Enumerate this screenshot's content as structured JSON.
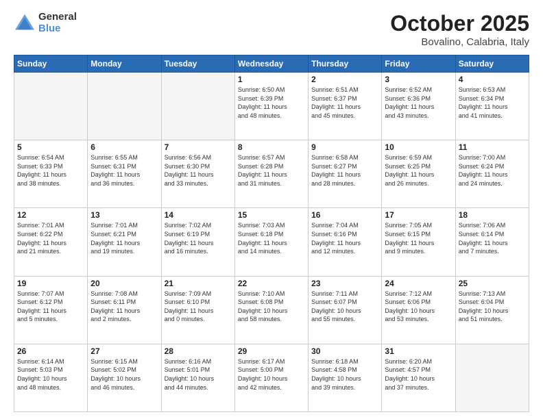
{
  "header": {
    "logo_line1": "General",
    "logo_line2": "Blue",
    "title": "October 2025",
    "subtitle": "Bovalino, Calabria, Italy"
  },
  "days_of_week": [
    "Sunday",
    "Monday",
    "Tuesday",
    "Wednesday",
    "Thursday",
    "Friday",
    "Saturday"
  ],
  "weeks": [
    {
      "days": [
        {
          "num": "",
          "info": ""
        },
        {
          "num": "",
          "info": ""
        },
        {
          "num": "",
          "info": ""
        },
        {
          "num": "1",
          "info": "Sunrise: 6:50 AM\nSunset: 6:39 PM\nDaylight: 11 hours\nand 48 minutes."
        },
        {
          "num": "2",
          "info": "Sunrise: 6:51 AM\nSunset: 6:37 PM\nDaylight: 11 hours\nand 45 minutes."
        },
        {
          "num": "3",
          "info": "Sunrise: 6:52 AM\nSunset: 6:36 PM\nDaylight: 11 hours\nand 43 minutes."
        },
        {
          "num": "4",
          "info": "Sunrise: 6:53 AM\nSunset: 6:34 PM\nDaylight: 11 hours\nand 41 minutes."
        }
      ]
    },
    {
      "days": [
        {
          "num": "5",
          "info": "Sunrise: 6:54 AM\nSunset: 6:33 PM\nDaylight: 11 hours\nand 38 minutes."
        },
        {
          "num": "6",
          "info": "Sunrise: 6:55 AM\nSunset: 6:31 PM\nDaylight: 11 hours\nand 36 minutes."
        },
        {
          "num": "7",
          "info": "Sunrise: 6:56 AM\nSunset: 6:30 PM\nDaylight: 11 hours\nand 33 minutes."
        },
        {
          "num": "8",
          "info": "Sunrise: 6:57 AM\nSunset: 6:28 PM\nDaylight: 11 hours\nand 31 minutes."
        },
        {
          "num": "9",
          "info": "Sunrise: 6:58 AM\nSunset: 6:27 PM\nDaylight: 11 hours\nand 28 minutes."
        },
        {
          "num": "10",
          "info": "Sunrise: 6:59 AM\nSunset: 6:25 PM\nDaylight: 11 hours\nand 26 minutes."
        },
        {
          "num": "11",
          "info": "Sunrise: 7:00 AM\nSunset: 6:24 PM\nDaylight: 11 hours\nand 24 minutes."
        }
      ]
    },
    {
      "days": [
        {
          "num": "12",
          "info": "Sunrise: 7:01 AM\nSunset: 6:22 PM\nDaylight: 11 hours\nand 21 minutes."
        },
        {
          "num": "13",
          "info": "Sunrise: 7:01 AM\nSunset: 6:21 PM\nDaylight: 11 hours\nand 19 minutes."
        },
        {
          "num": "14",
          "info": "Sunrise: 7:02 AM\nSunset: 6:19 PM\nDaylight: 11 hours\nand 16 minutes."
        },
        {
          "num": "15",
          "info": "Sunrise: 7:03 AM\nSunset: 6:18 PM\nDaylight: 11 hours\nand 14 minutes."
        },
        {
          "num": "16",
          "info": "Sunrise: 7:04 AM\nSunset: 6:16 PM\nDaylight: 11 hours\nand 12 minutes."
        },
        {
          "num": "17",
          "info": "Sunrise: 7:05 AM\nSunset: 6:15 PM\nDaylight: 11 hours\nand 9 minutes."
        },
        {
          "num": "18",
          "info": "Sunrise: 7:06 AM\nSunset: 6:14 PM\nDaylight: 11 hours\nand 7 minutes."
        }
      ]
    },
    {
      "days": [
        {
          "num": "19",
          "info": "Sunrise: 7:07 AM\nSunset: 6:12 PM\nDaylight: 11 hours\nand 5 minutes."
        },
        {
          "num": "20",
          "info": "Sunrise: 7:08 AM\nSunset: 6:11 PM\nDaylight: 11 hours\nand 2 minutes."
        },
        {
          "num": "21",
          "info": "Sunrise: 7:09 AM\nSunset: 6:10 PM\nDaylight: 11 hours\nand 0 minutes."
        },
        {
          "num": "22",
          "info": "Sunrise: 7:10 AM\nSunset: 6:08 PM\nDaylight: 10 hours\nand 58 minutes."
        },
        {
          "num": "23",
          "info": "Sunrise: 7:11 AM\nSunset: 6:07 PM\nDaylight: 10 hours\nand 55 minutes."
        },
        {
          "num": "24",
          "info": "Sunrise: 7:12 AM\nSunset: 6:06 PM\nDaylight: 10 hours\nand 53 minutes."
        },
        {
          "num": "25",
          "info": "Sunrise: 7:13 AM\nSunset: 6:04 PM\nDaylight: 10 hours\nand 51 minutes."
        }
      ]
    },
    {
      "days": [
        {
          "num": "26",
          "info": "Sunrise: 6:14 AM\nSunset: 5:03 PM\nDaylight: 10 hours\nand 48 minutes."
        },
        {
          "num": "27",
          "info": "Sunrise: 6:15 AM\nSunset: 5:02 PM\nDaylight: 10 hours\nand 46 minutes."
        },
        {
          "num": "28",
          "info": "Sunrise: 6:16 AM\nSunset: 5:01 PM\nDaylight: 10 hours\nand 44 minutes."
        },
        {
          "num": "29",
          "info": "Sunrise: 6:17 AM\nSunset: 5:00 PM\nDaylight: 10 hours\nand 42 minutes."
        },
        {
          "num": "30",
          "info": "Sunrise: 6:18 AM\nSunset: 4:58 PM\nDaylight: 10 hours\nand 39 minutes."
        },
        {
          "num": "31",
          "info": "Sunrise: 6:20 AM\nSunset: 4:57 PM\nDaylight: 10 hours\nand 37 minutes."
        },
        {
          "num": "",
          "info": ""
        }
      ]
    }
  ]
}
